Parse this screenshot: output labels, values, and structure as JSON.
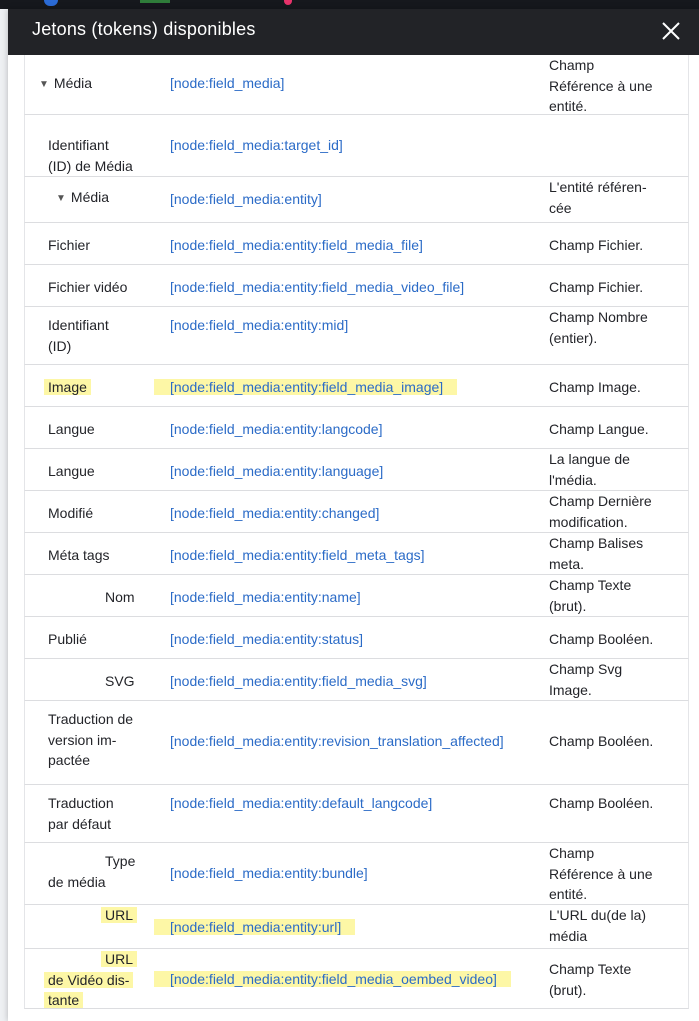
{
  "dialog": {
    "title": "Jetons (tokens) disponibles",
    "close_icon": "close-icon"
  },
  "colors": {
    "titlebar": "#222327",
    "token_link": "#2b6bc7",
    "highlight": "#fdf7a6"
  },
  "rows": [
    {
      "name": "Média",
      "name_lines": [
        "Média"
      ],
      "expander": true,
      "token": "[node:field_media]",
      "desc_lines": [
        "Champ",
        "Référence à une",
        "entité."
      ]
    },
    {
      "name": "Identifiant (ID) de Média",
      "name_lines": [
        "Identifiant",
        "(ID) de Média"
      ],
      "token": "[node:field_media:target_id]",
      "desc_lines": []
    },
    {
      "name": "Média",
      "name_lines": [
        "Média"
      ],
      "expander": true,
      "token": "[node:field_media:entity]",
      "desc_lines": [
        "L'entité référen-",
        "cée"
      ]
    },
    {
      "name": "Fichier",
      "name_lines": [
        "Fichier"
      ],
      "token": "[node:field_media:entity:field_media_file]",
      "desc_lines": [
        "Champ Fichier."
      ]
    },
    {
      "name": "Fichier vidéo",
      "name_lines": [
        "Fichier vidéo"
      ],
      "token": "[node:field_media:entity:field_media_video_file]",
      "desc_lines": [
        "Champ Fichier."
      ]
    },
    {
      "name": "Identifiant (ID)",
      "name_lines": [
        "Identifiant",
        "(ID)"
      ],
      "token": "[node:field_media:entity:mid]",
      "desc_lines": [
        "Champ Nombre",
        "(entier)."
      ]
    },
    {
      "name": "Image",
      "name_lines": [
        "Image"
      ],
      "highlight": true,
      "token": "[node:field_media:entity:field_media_image]",
      "desc_lines": [
        "Champ Image."
      ]
    },
    {
      "name": "Langue",
      "name_lines": [
        "Langue"
      ],
      "token": "[node:field_media:entity:langcode]",
      "desc_lines": [
        "Champ Langue."
      ]
    },
    {
      "name": "Langue",
      "name_lines": [
        "Langue"
      ],
      "token": "[node:field_media:entity:language]",
      "desc_lines": [
        "La langue de",
        "l'média."
      ]
    },
    {
      "name": "Modifié",
      "name_lines": [
        "Modifié"
      ],
      "token": "[node:field_media:entity:changed]",
      "desc_lines": [
        "Champ Dernière",
        "modification."
      ]
    },
    {
      "name": "Méta tags",
      "name_lines": [
        "Méta tags"
      ],
      "token": "[node:field_media:entity:field_meta_tags]",
      "desc_lines": [
        "Champ Balises",
        "meta."
      ]
    },
    {
      "name": "Nom",
      "name_lines": [
        "Nom"
      ],
      "token": "[node:field_media:entity:name]",
      "desc_lines": [
        "Champ Texte",
        "(brut)."
      ]
    },
    {
      "name": "Publié",
      "name_lines": [
        "Publié"
      ],
      "token": "[node:field_media:entity:status]",
      "desc_lines": [
        "Champ Booléen."
      ]
    },
    {
      "name": "SVG",
      "name_lines": [
        "SVG"
      ],
      "token": "[node:field_media:entity:field_media_svg]",
      "desc_lines": [
        "Champ Svg",
        "Image."
      ]
    },
    {
      "name": "Traduction de version impactée",
      "name_lines": [
        "Traduction de",
        "version im-",
        "pactée"
      ],
      "token": "[node:field_media:entity:revision_translation_affected]",
      "desc_lines": [
        "Champ Booléen."
      ]
    },
    {
      "name": "Traduction par défaut",
      "name_lines": [
        "Traduction",
        "par défaut"
      ],
      "token": "[node:field_media:entity:default_langcode]",
      "desc_lines": [
        "Champ Booléen."
      ]
    },
    {
      "name": "Type de média",
      "name_lines": [
        "Type",
        "de média"
      ],
      "token": "[node:field_media:entity:bundle]",
      "desc_lines": [
        "Champ",
        "Référence à une",
        "entité."
      ]
    },
    {
      "name": "URL",
      "name_lines": [
        "URL"
      ],
      "highlight": true,
      "token": "[node:field_media:entity:url]",
      "desc_lines": [
        "L'URL du(de la)",
        "média"
      ]
    },
    {
      "name": "URL de Vidéo distante",
      "name_lines": [
        "URL",
        "de Vidéo dis-",
        "tante"
      ],
      "highlight": true,
      "token": "[node:field_media:entity:field_media_oembed_video]",
      "desc_lines": [
        "Champ Texte",
        "(brut)."
      ]
    }
  ]
}
